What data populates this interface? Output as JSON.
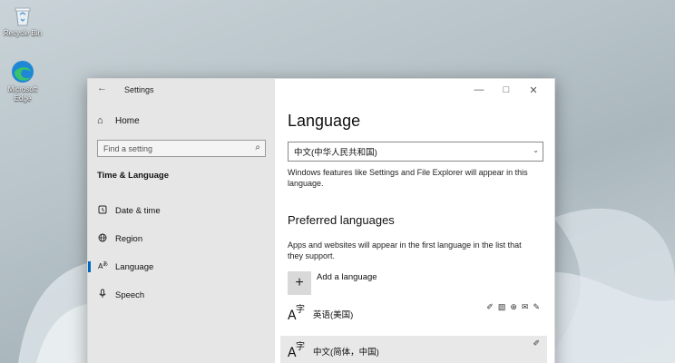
{
  "desktop": {
    "recycle_bin_label": "Recycle Bin",
    "edge_label": "Microsoft Edge"
  },
  "window": {
    "title": "Settings",
    "back_icon": "←",
    "minimize_icon": "—",
    "maximize_icon": "□",
    "close_icon": "✕"
  },
  "nav": {
    "home_label": "Home",
    "home_icon": "⌂",
    "search_placeholder": "Find a setting",
    "search_icon": "⌕",
    "section_label": "Time & Language",
    "items": [
      {
        "label": "Date & time",
        "icon": "◱",
        "active": false
      },
      {
        "label": "Region",
        "icon": "◌",
        "active": false
      },
      {
        "label": "Language",
        "icon": "А́",
        "active": true
      },
      {
        "label": "Speech",
        "icon": "⊙",
        "active": false
      }
    ]
  },
  "content": {
    "title": "Language",
    "display_language_value": "中文(中华人民共和国)",
    "display_language_chevron": "⌄",
    "display_language_desc": "Windows features like Settings and File Explorer will appear in this language.",
    "preferred_heading": "Preferred languages",
    "preferred_desc": "Apps and websites will appear in the first language in the list that they support.",
    "add_icon": "+",
    "add_label": "Add a language",
    "languages": [
      {
        "name": "英语(美国)",
        "icon": "A字",
        "features": [
          "✐",
          "▧",
          "⊕",
          "✉",
          "✎"
        ]
      },
      {
        "name": "中文(简体，中国)",
        "icon": "A字",
        "features": [
          "✐"
        ]
      }
    ]
  },
  "colors": {
    "accent": "#0067c0",
    "nav_bg": "#e6e6e6",
    "content_bg": "#ffffff"
  }
}
